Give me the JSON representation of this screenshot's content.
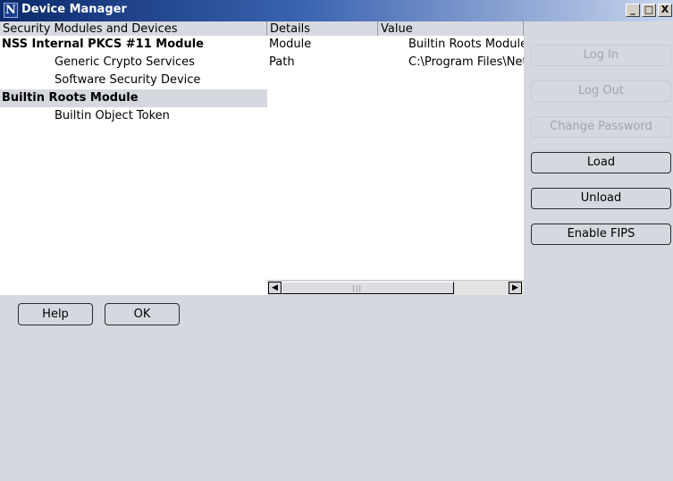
{
  "window": {
    "title": "Device Manager",
    "app_icon_letter": "N",
    "controls": {
      "minimize": "_",
      "maximize": "□",
      "close": "X"
    }
  },
  "tree": {
    "header": "Security Modules and Devices",
    "items": [
      {
        "label": "NSS Internal PKCS #11 Module"
      },
      {
        "label": "Generic Crypto Services"
      },
      {
        "label": "Software Security Device"
      },
      {
        "label": "Builtin Roots Module"
      },
      {
        "label": "Builtin Object Token"
      }
    ]
  },
  "details": {
    "headers": {
      "details": "Details",
      "value": "Value"
    },
    "rows": [
      {
        "detail": "Module",
        "value": "Builtin Roots Module"
      },
      {
        "detail": "Path",
        "value": "C:\\Program Files\\Netscape"
      }
    ],
    "scrollbar": {
      "left_arrow": "◀",
      "right_arrow": "▶",
      "grip": "|||"
    }
  },
  "actions": {
    "log_in": "Log In",
    "log_out": "Log Out",
    "change_password": "Change Password",
    "load": "Load",
    "unload": "Unload",
    "enable_fips": "Enable FIPS"
  },
  "footer": {
    "help": "Help",
    "ok": "OK"
  }
}
